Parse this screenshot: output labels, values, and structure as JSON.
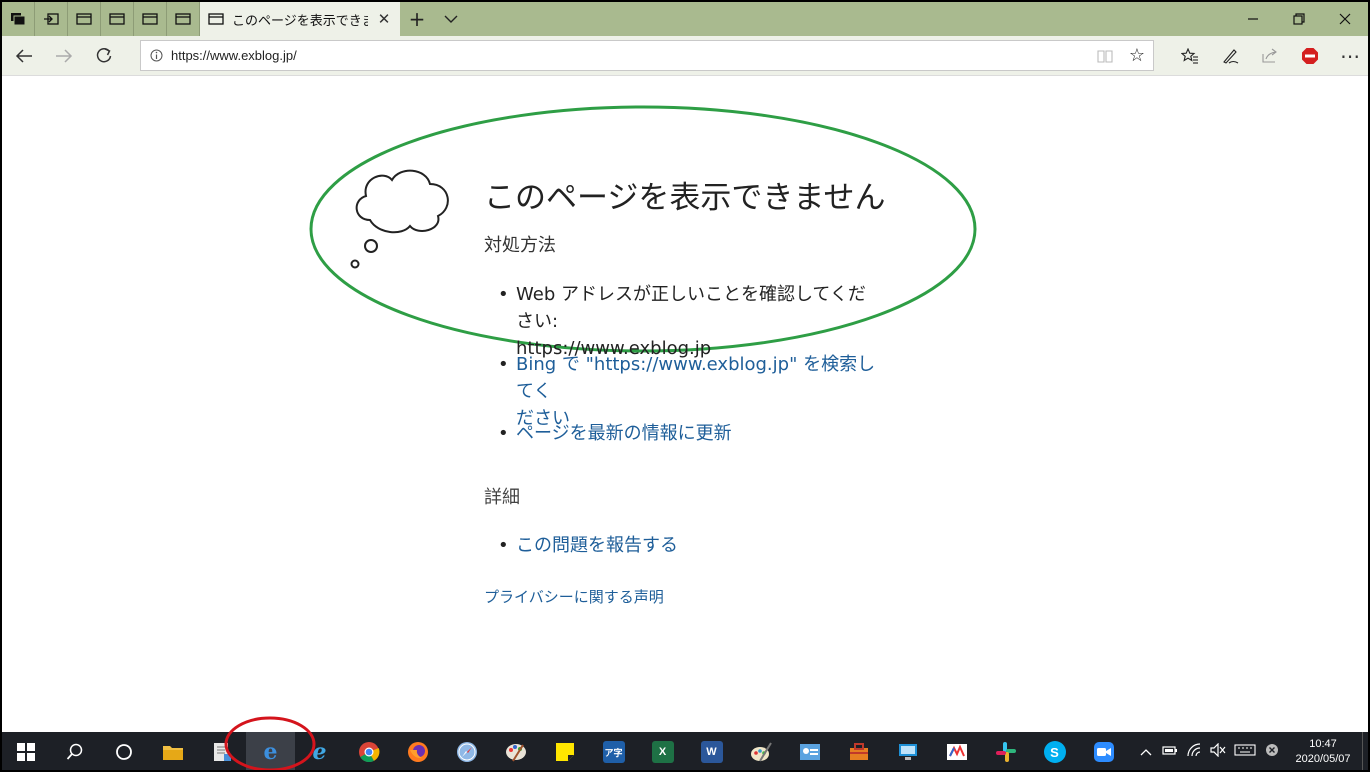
{
  "browser": {
    "tab_title": "このページを表示できません",
    "url": "https://www.exblog.jp/"
  },
  "page": {
    "title": "このページを表示できません",
    "subtitle": "対処方法",
    "bullet1_line1": "Web アドレスが正しいことを確認してください:",
    "bullet1_line2": "https://www.exblog.jp",
    "bullet2_line1": "Bing で \"https://www.exblog.jp\" を検索してく",
    "bullet2_line2": "ださい",
    "bullet3": "ページを最新の情報に更新",
    "details_heading": "詳細",
    "report_link": "この問題を報告する",
    "privacy_link": "プライバシーに関する声明"
  },
  "taskbar": {
    "clock_time": "10:47",
    "clock_date": "2020/05/07",
    "sticky_label": "",
    "excel_label": "X",
    "word_label": "W",
    "skype_label": "S"
  },
  "colors": {
    "tabbar": "#a9ba8f",
    "toolbar": "#eef1e8",
    "link": "#1e5e99",
    "ellipse_annotation": "#2e9e45",
    "ring_annotation": "#d4141c",
    "taskbar": "#1d2026"
  }
}
